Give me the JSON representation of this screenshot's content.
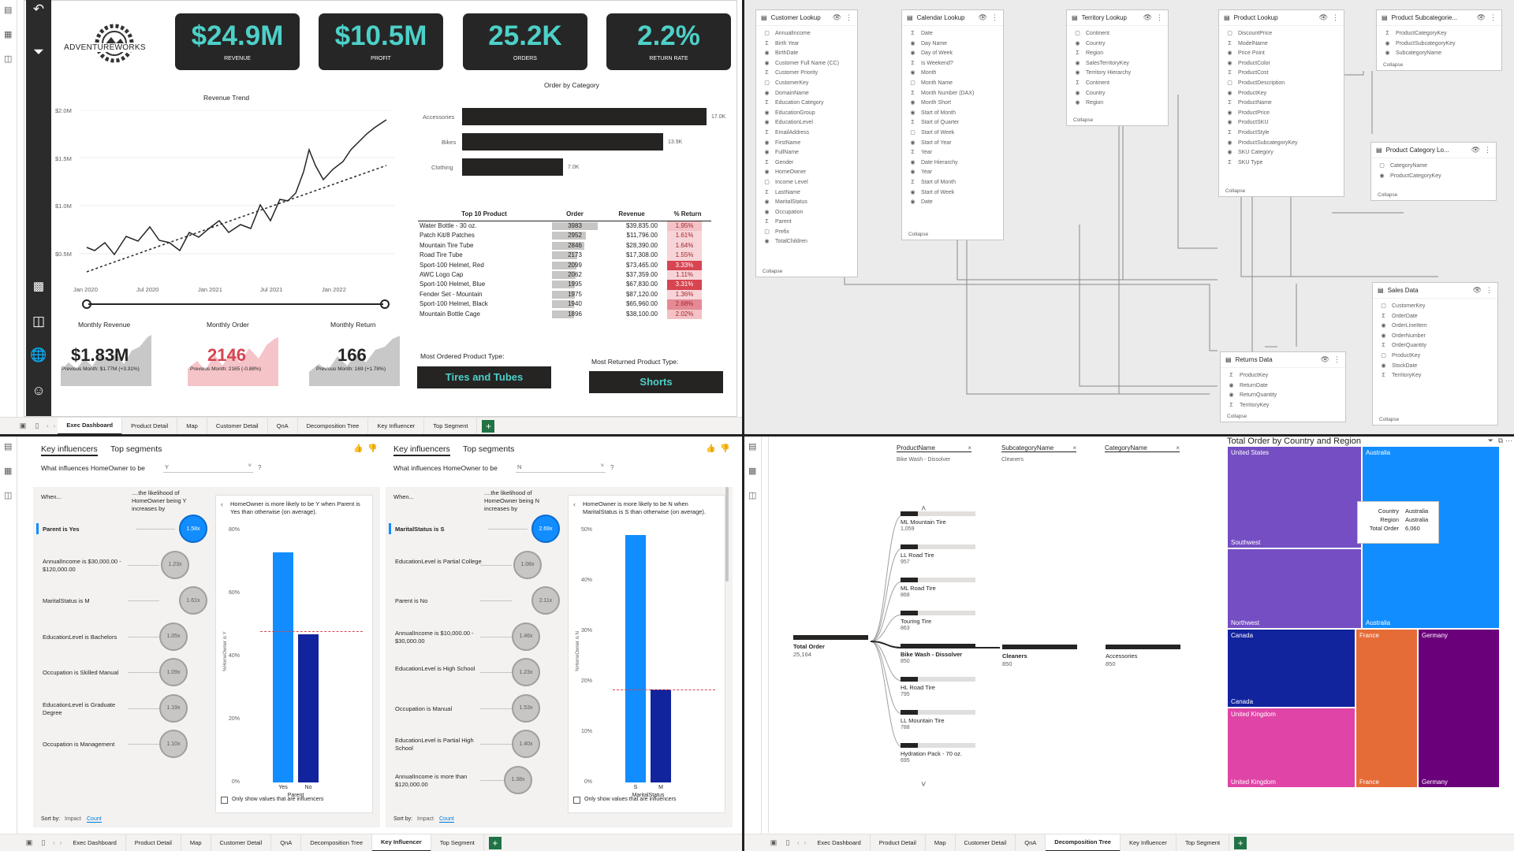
{
  "q1": {
    "brand": "ADVENTUREWORKS",
    "kpis": [
      {
        "value": "$24.9M",
        "label": "REVENUE"
      },
      {
        "value": "$10.5M",
        "label": "PROFIT"
      },
      {
        "value": "25.2K",
        "label": "ORDERS"
      },
      {
        "value": "2.2%",
        "label": "RETURN RATE"
      }
    ],
    "revenue_trend": {
      "title": "Revenue Trend",
      "y_ticks": [
        "$2.0M",
        "$1.5M",
        "$1.0M",
        "$0.5M"
      ],
      "x_ticks": [
        "Jan 2020",
        "Jul 2020",
        "Jan 2021",
        "Jul 2021",
        "Jan 2022"
      ]
    },
    "order_by_category": {
      "title": "Order by Category",
      "rows": [
        {
          "name": "Accessories",
          "value": "17.0K",
          "v": 17.0
        },
        {
          "name": "Bikes",
          "value": "13.9K",
          "v": 13.9
        },
        {
          "name": "Clothing",
          "value": "7.0K",
          "v": 7.0
        }
      ]
    },
    "top10": {
      "headers": [
        "Top 10 Product",
        "Order",
        "Revenue",
        "% Return"
      ],
      "rows": [
        [
          "Water Bottle - 30 oz.",
          "3983",
          "$39,835.00",
          "1.95%"
        ],
        [
          "Patch Kit/8 Patches",
          "2952",
          "$11,796.00",
          "1.61%"
        ],
        [
          "Mountain Tire Tube",
          "2846",
          "$28,390.00",
          "1.64%"
        ],
        [
          "Road Tire Tube",
          "2173",
          "$17,308.00",
          "1.55%"
        ],
        [
          "Sport-100 Helmet, Red",
          "2099",
          "$73,465.00",
          "3.33%"
        ],
        [
          "AWC Logo Cap",
          "2062",
          "$37,359.00",
          "1.11%"
        ],
        [
          "Sport-100 Helmet, Blue",
          "1995",
          "$67,830.00",
          "3.31%"
        ],
        [
          "Fender Set - Mountain",
          "1975",
          "$87,120.00",
          "1.36%"
        ],
        [
          "Sport-100 Helmet, Black",
          "1940",
          "$65,960.00",
          "2.68%"
        ],
        [
          "Mountain Bottle Cage",
          "1896",
          "$38,100.00",
          "2.02%"
        ]
      ]
    },
    "monthly": [
      {
        "title": "Monthly Revenue",
        "value": "$1.83M",
        "sub": "Previous Month: $1.77M (+3.31%)",
        "color": "#252423"
      },
      {
        "title": "Monthly Order",
        "value": "2146",
        "sub": "Previous Month: 2165 (-0.88%)",
        "color": "#d64550"
      },
      {
        "title": "Monthly Return",
        "value": "166",
        "sub": "Previous Month: 169 (+1.78%)",
        "color": "#252423"
      }
    ],
    "most_ordered": {
      "label": "Most Ordered Product Type:",
      "value": "Tires and Tubes"
    },
    "most_returned": {
      "label": "Most Returned Product Type:",
      "value": "Shorts"
    },
    "tabs": [
      "Exec Dashboard",
      "Product Detail",
      "Map",
      "Customer Detail",
      "QnA",
      "Decomposition Tree",
      "Key Influencer",
      "Top Segment"
    ]
  },
  "q2": {
    "tables": [
      {
        "title": "Customer Lookup",
        "fields": [
          "AnnualIncome",
          "Birth Year",
          "BirthDate",
          "Customer Full Name (CC)",
          "Customer Priority",
          "CustomerKey",
          "DomainName",
          "Education Category",
          "EducationGroup",
          "EducationLevel",
          "EmailAddress",
          "FirstName",
          "FullName",
          "Gender",
          "HomeOwner",
          "Income Level",
          "LastName",
          "MaritalStatus",
          "Occupation",
          "Parent",
          "Prefix",
          "TotalChildren"
        ],
        "collapse": "Collapse"
      },
      {
        "title": "Calendar Lookup",
        "fields": [
          "Date",
          "Day Name",
          "Day of Week",
          "Is Weekend?",
          "Month",
          "Month Name",
          "Month Number (DAX)",
          "Month Short",
          "Start of Month",
          "Start of Quarter",
          "Start of Week",
          "Start of Year",
          "Year",
          "Date Hierarchy",
          "Year",
          "Start of Month",
          "Start of Week",
          "Date"
        ],
        "collapse": "Collapse"
      },
      {
        "title": "Territory Lookup",
        "fields": [
          "Continent",
          "Country",
          "Region",
          "SalesTerritoryKey",
          "Territory Hierarchy",
          "Continent",
          "Country",
          "Region"
        ],
        "collapse": "Collapse"
      },
      {
        "title": "Product Lookup",
        "fields": [
          "DiscountPrice",
          "ModelName",
          "Price Point",
          "ProductColor",
          "ProductCost",
          "ProductDescription",
          "ProductKey",
          "ProductName",
          "ProductPrice",
          "ProductSKU",
          "ProductStyle",
          "ProductSubcategoryKey",
          "SKU Category",
          "SKU Type"
        ],
        "collapse": "Collapse"
      },
      {
        "title": "Product Subcategorie...",
        "fields": [
          "ProductCategoryKey",
          "ProductSubcategoryKey",
          "SubcategoryName"
        ],
        "collapse": "Collapse"
      },
      {
        "title": "Product Category Lo...",
        "fields": [
          "CategoryName",
          "ProductCategoryKey"
        ],
        "collapse": "Collapse"
      },
      {
        "title": "Sales Data",
        "fields": [
          "CustomerKey",
          "OrderDate",
          "OrderLineItem",
          "OrderNumber",
          "OrderQuantity",
          "ProductKey",
          "StockDate",
          "TerritoryKey"
        ],
        "collapse": "Collapse"
      },
      {
        "title": "Returns Data",
        "fields": [
          "ProductKey",
          "ReturnDate",
          "ReturnQuantity",
          "TerritoryKey"
        ],
        "collapse": "Collapse"
      }
    ]
  },
  "q3": {
    "panels": [
      {
        "tab1": "Key influencers",
        "tab2": "Top segments",
        "question": "What influences HomeOwner to be",
        "select": "Y",
        "when": "When...",
        "likelihood": "....the likelihood of HomeOwner being Y increases by",
        "items": [
          [
            "Parent is Yes",
            "1.58x"
          ],
          [
            "AnnualIncome is $30,000.00 - $120,000.00",
            "1.23x"
          ],
          [
            "MaritalStatus is M",
            "1.61x"
          ],
          [
            "EducationLevel is Bachelors",
            "1.05x"
          ],
          [
            "Occupation is Skilled Manual",
            "1.09x"
          ],
          [
            "EducationLevel is Graduate Degree",
            "1.19x"
          ],
          [
            "Occupation is Management",
            "1.10x"
          ]
        ],
        "detail": "HomeOwner is more likely to be Y when Parent is Yes than otherwise (on average).",
        "yaxis": "%HomeOwner is Y",
        "y_ticks": [
          "80%",
          "60%",
          "40%",
          "20%",
          "0%"
        ],
        "bars": [
          {
            "name": "Yes",
            "value": 73
          },
          {
            "name": "No",
            "value": 47
          }
        ],
        "avg": 48,
        "xaxis": "Parent",
        "only": "Only show values that are influencers",
        "sort": "Sort by:",
        "impact": "Impact",
        "count": "Count"
      },
      {
        "tab1": "Key influencers",
        "tab2": "Top segments",
        "question": "What influences HomeOwner to be",
        "select": "N",
        "when": "When...",
        "likelihood": "....the likelihood of HomeOwner being N increases by",
        "items": [
          [
            "MaritalStatus is S",
            "2.69x"
          ],
          [
            "EducationLevel is Partial College",
            "1.08x"
          ],
          [
            "Parent is No",
            "2.11x"
          ],
          [
            "AnnualIncome is $10,000.00 - $30,000.00",
            "1.46x"
          ],
          [
            "EducationLevel is High School",
            "1.23x"
          ],
          [
            "Occupation is Manual",
            "1.53x"
          ],
          [
            "EducationLevel is Partial High School",
            "1.40x"
          ],
          [
            "AnnualIncome is more than $120,000.00",
            "1.38x"
          ]
        ],
        "detail": "HomeOwner is more likely to be N when MaritalStatus is S than otherwise (on average).",
        "yaxis": "%HomeOwner is N",
        "y_ticks": [
          "50%",
          "40%",
          "30%",
          "20%",
          "10%",
          "0%"
        ],
        "bars": [
          {
            "name": "S",
            "value": 49
          },
          {
            "name": "M",
            "value": 18.5
          }
        ],
        "avg": 18.5,
        "xaxis": "MaritalStatus",
        "only": "Only show values that are influencers",
        "sort": "Sort by:",
        "impact": "Impact",
        "count": "Count"
      }
    ],
    "tabs": [
      "Exec Dashboard",
      "Product Detail",
      "Map",
      "Customer Detail",
      "QnA",
      "Decomposition Tree",
      "Key Influencer",
      "Top Segment"
    ]
  },
  "q4": {
    "filters": [
      {
        "name": "ProductName",
        "value": "Bike Wash - Dissolver"
      },
      {
        "name": "SubcategoryName",
        "value": "Cleaners"
      },
      {
        "name": "CategoryName",
        "value": ""
      }
    ],
    "root": {
      "label": "Total Order",
      "value": "25,164"
    },
    "products": [
      [
        "ML Mountain Tire",
        "1,059"
      ],
      [
        "LL Road Tire",
        "957"
      ],
      [
        "ML Road Tire",
        "868"
      ],
      [
        "Touring Tire",
        "863"
      ],
      [
        "Bike Wash - Dissolver",
        "850"
      ],
      [
        "HL Road Tire",
        "795"
      ],
      [
        "LL Mountain Tire",
        "788"
      ],
      [
        "Hydration Pack - 70 oz.",
        "695"
      ]
    ],
    "sub": {
      "label": "Cleaners",
      "value": "850"
    },
    "cat": {
      "label": "Accessories",
      "value": "850"
    },
    "treemap": {
      "title": "Total Order by Country and Region",
      "cells": [
        {
          "country": "United States",
          "region": "Southwest",
          "color": "#744ec2"
        },
        {
          "country": "United States",
          "region": "Northwest",
          "color": "#744ec2"
        },
        {
          "country": "Australia",
          "region": "Australia",
          "color": "#118dff"
        },
        {
          "country": "Canada",
          "region": "Canada",
          "color": "#12239e"
        },
        {
          "country": "France",
          "region": "France",
          "color": "#e66c37"
        },
        {
          "country": "Germany",
          "region": "Germany",
          "color": "#6b007b"
        },
        {
          "country": "United Kingdom",
          "region": "United Kingdom",
          "color": "#e044a7"
        }
      ],
      "tooltip": {
        "k1": "Country",
        "v1": "Australia",
        "k2": "Region",
        "v2": "Australia",
        "k3": "Total Order",
        "v3": "6,060"
      }
    },
    "tabs": [
      "Exec Dashboard",
      "Product Detail",
      "Map",
      "Customer Detail",
      "QnA",
      "Decomposition Tree",
      "Key Influencer",
      "Top Segment"
    ]
  }
}
